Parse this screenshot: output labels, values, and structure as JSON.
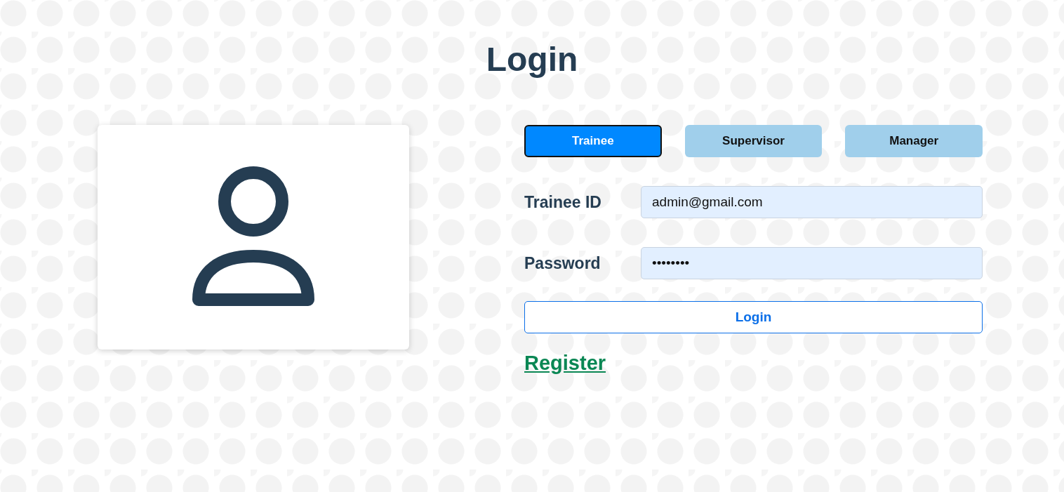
{
  "title": "Login",
  "roles": [
    {
      "label": "Trainee",
      "selected": true
    },
    {
      "label": "Supervisor",
      "selected": false
    },
    {
      "label": "Manager",
      "selected": false
    }
  ],
  "fields": [
    {
      "label": "Trainee ID",
      "value": "admin@gmail.com"
    },
    {
      "label": "Password",
      "value": "••••••••"
    }
  ],
  "login_button": "Login",
  "register_link": "Register"
}
